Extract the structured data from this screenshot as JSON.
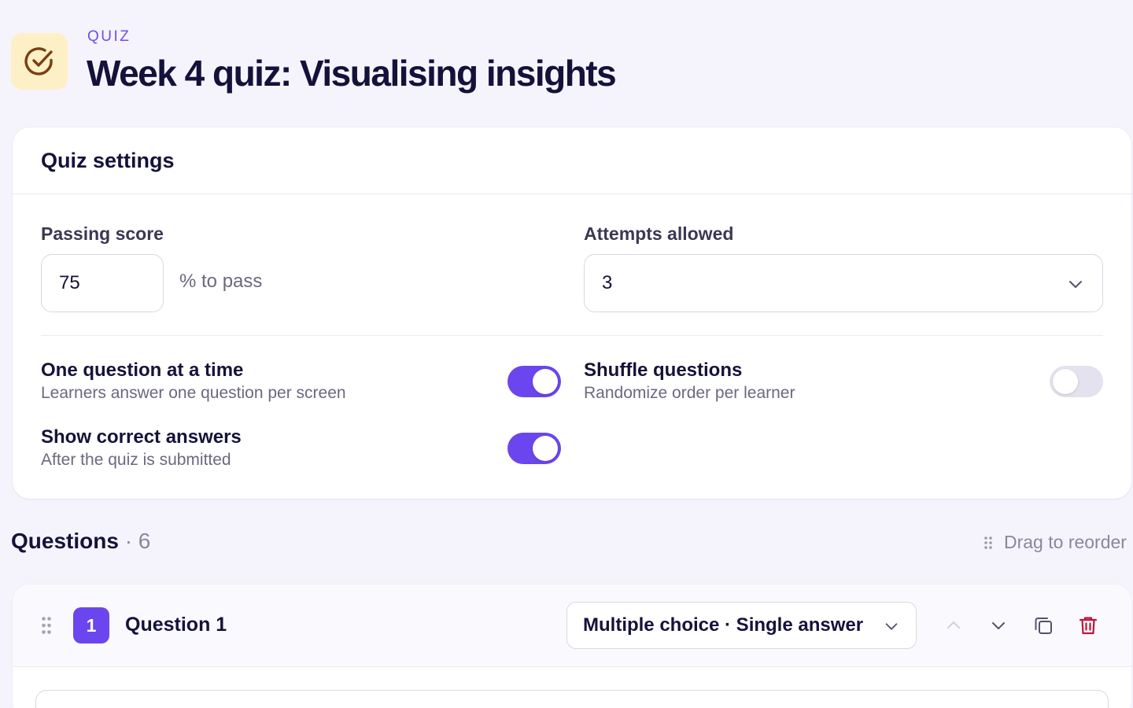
{
  "header": {
    "eyebrow": "QUIZ",
    "title": "Week 4 quiz: Visualising insights",
    "icon": "check-circle-icon"
  },
  "settings": {
    "title": "Quiz settings",
    "passing_score": {
      "label": "Passing score",
      "value": "75",
      "suffix": "% to pass"
    },
    "attempts": {
      "label": "Attempts allowed",
      "value": "3"
    },
    "options": [
      {
        "title": "One question at a time",
        "description": "Learners answer one question per screen",
        "enabled": true
      },
      {
        "title": "Shuffle questions",
        "description": "Randomize order per learner",
        "enabled": false
      },
      {
        "title": "Show correct answers",
        "description": "After the quiz is submitted",
        "enabled": true
      }
    ]
  },
  "questions": {
    "heading": "Questions",
    "count": "· 6",
    "drag_hint": "Drag to reorder",
    "items": [
      {
        "number": "1",
        "title": "Question 1",
        "type": "Multiple choice · Single answer"
      }
    ]
  },
  "colors": {
    "accent": "#6b46ee",
    "danger": "#c0143c",
    "icon_bg": "#fdf0c6"
  }
}
